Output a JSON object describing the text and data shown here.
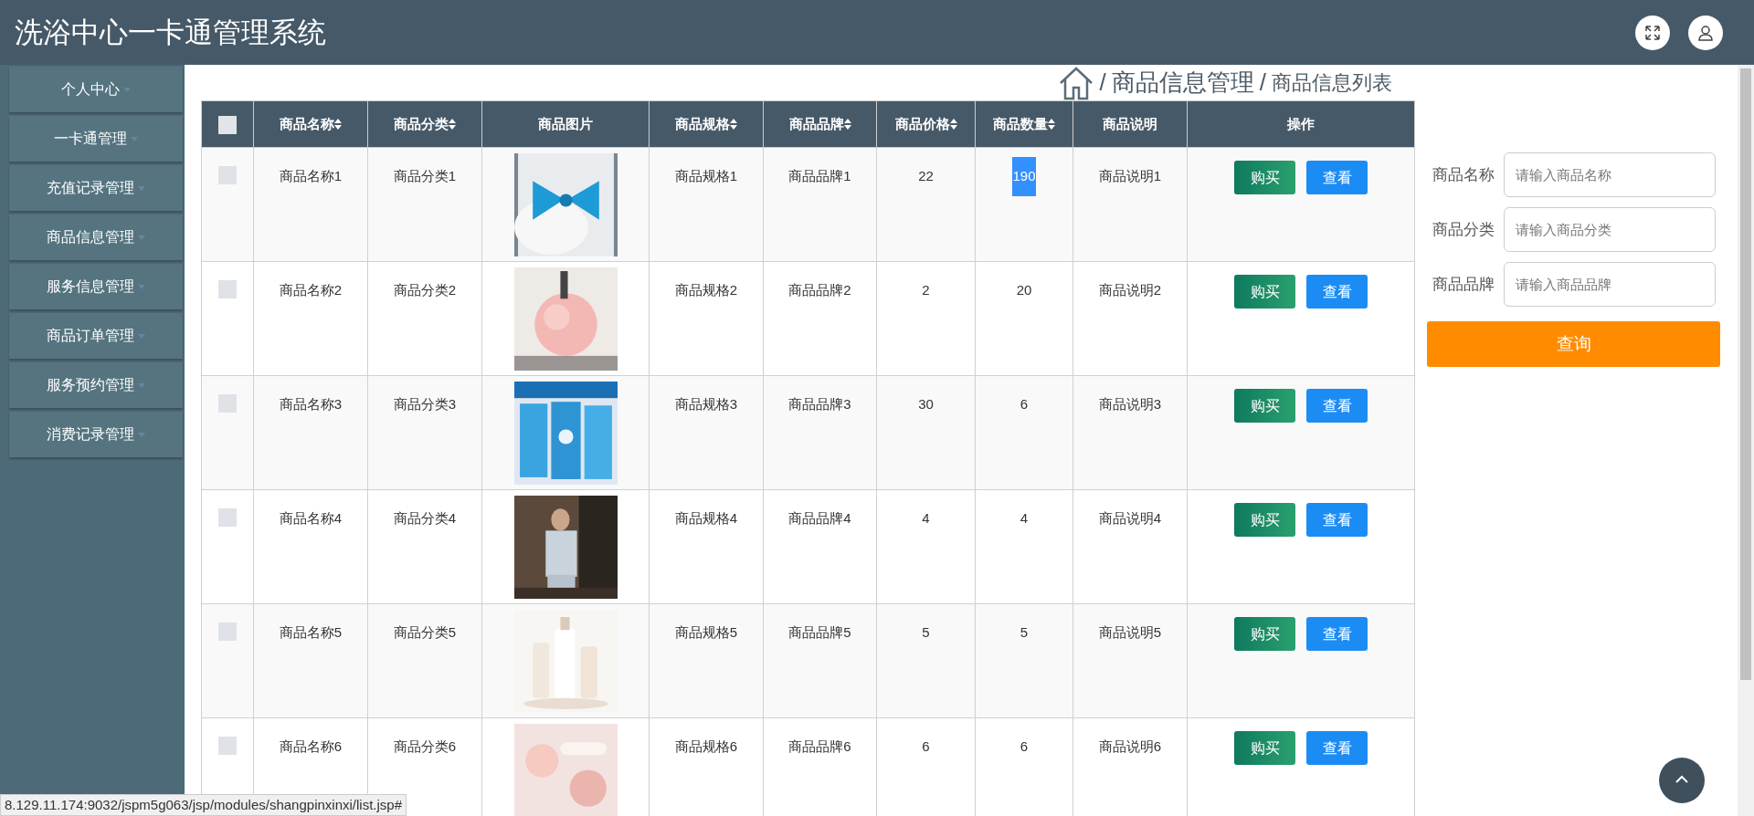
{
  "header": {
    "title": "洗浴中心一卡通管理系统"
  },
  "sidebar": {
    "items": [
      {
        "label": "个人中心"
      },
      {
        "label": "一卡通管理"
      },
      {
        "label": "充值记录管理"
      },
      {
        "label": "商品信息管理"
      },
      {
        "label": "服务信息管理"
      },
      {
        "label": "商品订单管理"
      },
      {
        "label": "服务预约管理"
      },
      {
        "label": "消费记录管理"
      }
    ]
  },
  "breadcrumb": [
    {
      "kind": "separator",
      "text": "/"
    },
    {
      "kind": "link",
      "text": "商品信息管理"
    },
    {
      "kind": "separator",
      "text": "/"
    },
    {
      "kind": "current",
      "text": "商品信息列表"
    }
  ],
  "select_all_checked": false,
  "table": {
    "columns": [
      {
        "label": "商品名称",
        "sortable": true
      },
      {
        "label": "商品分类",
        "sortable": true
      },
      {
        "label": "商品图片",
        "sortable": false
      },
      {
        "label": "商品规格",
        "sortable": true
      },
      {
        "label": "商品品牌",
        "sortable": true
      },
      {
        "label": "商品价格",
        "sortable": true
      },
      {
        "label": "商品数量",
        "sortable": true
      },
      {
        "label": "商品说明",
        "sortable": false
      },
      {
        "label": "操作",
        "sortable": false
      }
    ],
    "rows": [
      {
        "checked": false,
        "name": "商品名称1",
        "category": "商品分类1",
        "image": {
          "kind": "picture"
        },
        "spec": "商品规格1",
        "brand": "商品品牌1",
        "price": "22",
        "quantity": "190",
        "quantity_selected": true,
        "description": "商品说明1",
        "actions": [
          "购买",
          "查看"
        ]
      },
      {
        "checked": false,
        "name": "商品名称2",
        "category": "商品分类2",
        "image": {
          "kind": "picture"
        },
        "spec": "商品规格2",
        "brand": "商品品牌2",
        "price": "2",
        "quantity": "20",
        "quantity_selected": false,
        "description": "商品说明2",
        "actions": [
          "购买",
          "查看"
        ]
      },
      {
        "checked": false,
        "name": "商品名称3",
        "category": "商品分类3",
        "image": {
          "kind": "picture"
        },
        "spec": "商品规格3",
        "brand": "商品品牌3",
        "price": "30",
        "quantity": "6",
        "quantity_selected": false,
        "description": "商品说明3",
        "actions": [
          "购买",
          "查看"
        ]
      },
      {
        "checked": false,
        "name": "商品名称4",
        "category": "商品分类4",
        "image": {
          "kind": "picture"
        },
        "spec": "商品规格4",
        "brand": "商品品牌4",
        "price": "4",
        "quantity": "4",
        "quantity_selected": false,
        "description": "商品说明4",
        "actions": [
          "购买",
          "查看"
        ]
      },
      {
        "checked": false,
        "name": "商品名称5",
        "category": "商品分类5",
        "image": {
          "kind": "picture"
        },
        "spec": "商品规格5",
        "brand": "商品品牌5",
        "price": "5",
        "quantity": "5",
        "quantity_selected": false,
        "description": "商品说明5",
        "actions": [
          "购买",
          "查看"
        ]
      },
      {
        "checked": false,
        "name": "商品名称6",
        "category": "商品分类6",
        "image": {
          "kind": "picture"
        },
        "spec": "商品规格6",
        "brand": "商品品牌6",
        "price": "6",
        "quantity": "6",
        "quantity_selected": false,
        "description": "商品说明6",
        "actions": [
          "购买",
          "查看"
        ]
      }
    ]
  },
  "search": {
    "fields": [
      {
        "label": "商品名称",
        "placeholder": "请输入商品名称"
      },
      {
        "label": "商品分类",
        "placeholder": "请输入商品分类"
      },
      {
        "label": "商品品牌",
        "placeholder": "请输入商品品牌"
      }
    ],
    "button": "查询"
  },
  "status_bar": {
    "url": "8.129.11.174:9032/jspm5g063/jsp/modules/shangpinxinxi/list.jsp#"
  }
}
